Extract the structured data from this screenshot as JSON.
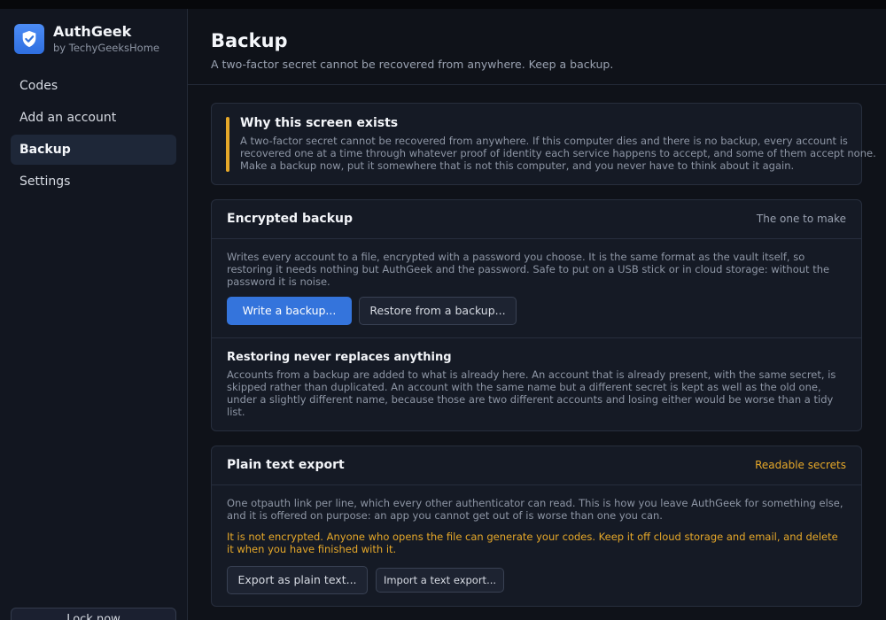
{
  "app": {
    "name": "AuthGeek",
    "by": "by TechyGeeksHome"
  },
  "sidebar": {
    "items": [
      {
        "label": "Codes"
      },
      {
        "label": "Add an account"
      },
      {
        "label": "Backup",
        "active": true
      },
      {
        "label": "Settings"
      }
    ],
    "lock_label": "Lock now"
  },
  "header": {
    "title": "Backup",
    "subtitle": "A two-factor secret cannot be recovered from anywhere. Keep a backup."
  },
  "info": {
    "title": "Why this screen exists",
    "text": "A two-factor secret cannot be recovered from anywhere. If this computer dies and there is no backup, every account is recovered one at a time through whatever proof of identity each service happens to accept, and some of them accept none. Make a backup now, put it somewhere that is not this computer, and you never have to think about it again."
  },
  "encrypted": {
    "title": "Encrypted backup",
    "tag": "The one to make",
    "text": "Writes every account to a file, encrypted with a password you choose. It is the same format as the vault itself, so restoring it needs nothing but AuthGeek and the password. Safe to put on a USB stick or in cloud storage: without the password it is noise.",
    "write_label": "Write a backup...",
    "restore_label": "Restore from a backup...",
    "restore_title": "Restoring never replaces anything",
    "restore_text": "Accounts from a backup are added to what is already here. An account that is already present, with the same secret, is skipped rather than duplicated. An account with the same name but a different secret is kept as well as the old one, under a slightly different name, because those are two different accounts and losing either would be worse than a tidy list."
  },
  "plain": {
    "title": "Plain text export",
    "tag": "Readable secrets",
    "text": "One otpauth link per line, which every other authenticator can read. This is how you leave AuthGeek for something else, and it is offered on purpose: an app you cannot get out of is worse than one you can.",
    "warning": "It is not encrypted. Anyone who opens the file can generate your codes. Keep it off cloud storage and email, and delete it when you have finished with it.",
    "export_label": "Export as plain text...",
    "import_label": "Import a text export..."
  },
  "colors": {
    "accent": "#3474dc",
    "warning": "#e6a829",
    "background": "#0f1219"
  }
}
